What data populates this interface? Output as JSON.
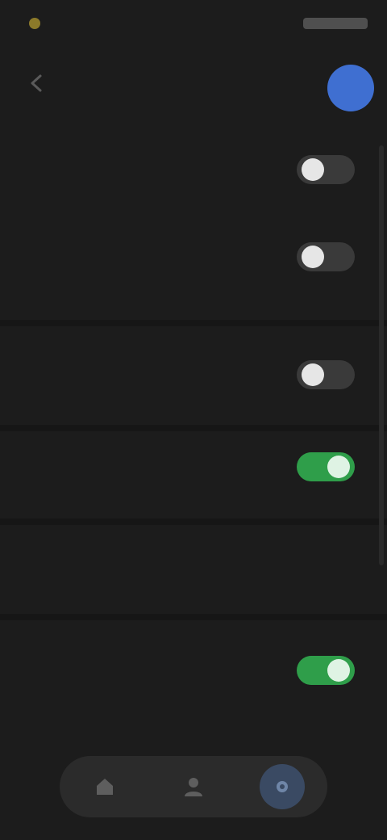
{
  "status_bar": {
    "icons": [
      "notification-dot-icon",
      "system-icons"
    ]
  },
  "top_bar": {
    "back_icon": "arrow-left-icon",
    "title": "",
    "avatar_color": "#3f6fd1"
  },
  "settings": {
    "row1": {
      "label": "",
      "description": "",
      "toggle_on": false
    },
    "row2": {
      "label": "",
      "description": "",
      "toggle_on": false
    },
    "section1_header": "",
    "row3": {
      "label": "",
      "toggle_on": false
    },
    "row4": {
      "label": "",
      "toggle_on": true
    },
    "row5": {
      "label": "",
      "description": "",
      "value": ""
    },
    "section2_header": "",
    "row6": {
      "label": "",
      "description": "",
      "toggle_on": true
    }
  },
  "bottom_nav": {
    "items": [
      "home-icon",
      "person-icon",
      "settings-icon"
    ],
    "active_index": 2
  },
  "colors": {
    "toggle_on": "#2f9e4a",
    "accent": "#3f6fd1",
    "background": "#1c1c1c"
  }
}
